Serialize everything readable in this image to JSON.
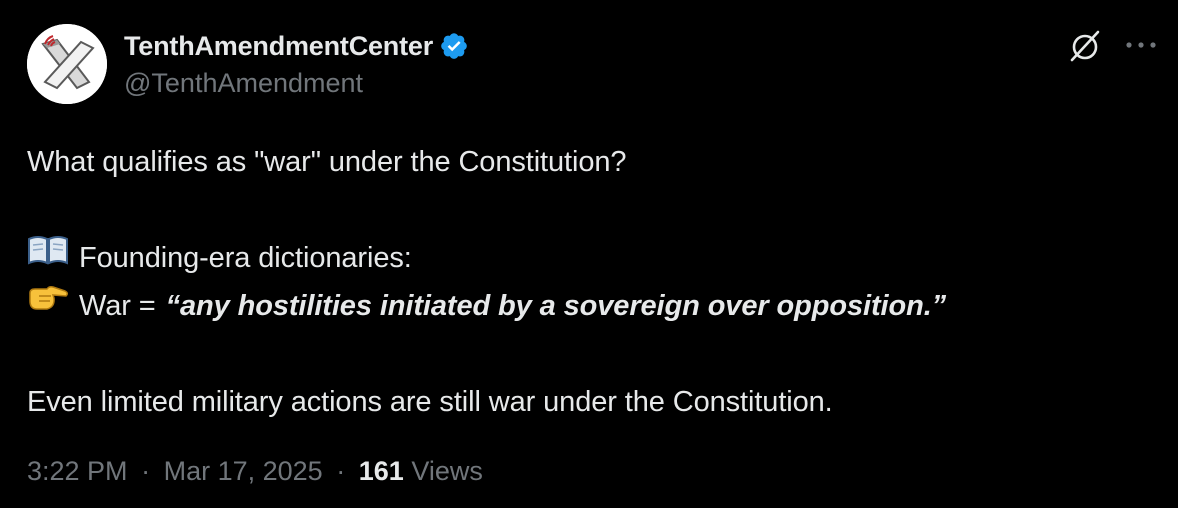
{
  "author": {
    "display_name": "TenthAmendmentCenter",
    "handle": "@TenthAmendment",
    "verified_icon": "verified-badge-icon",
    "badge_color": "#1d9bf0"
  },
  "header_actions": {
    "grok_icon": "grok-icon",
    "more_icon": "more-icon"
  },
  "tweet": {
    "line1": "What qualifies as \"war\" under the Constitution?",
    "line2_emoji": "book-icon",
    "line2": "Founding-era dictionaries:",
    "line3_emoji": "pointing-hand-icon",
    "line3_prefix": "War =",
    "line3_quote": "“any hostilities initiated by a sovereign over opposition.”",
    "line4": "Even limited military actions are still war under the Constitution."
  },
  "meta": {
    "time": "3:22 PM",
    "separator": "·",
    "date": "Mar 17, 2025",
    "views_count": "161",
    "views_label": "Views"
  }
}
